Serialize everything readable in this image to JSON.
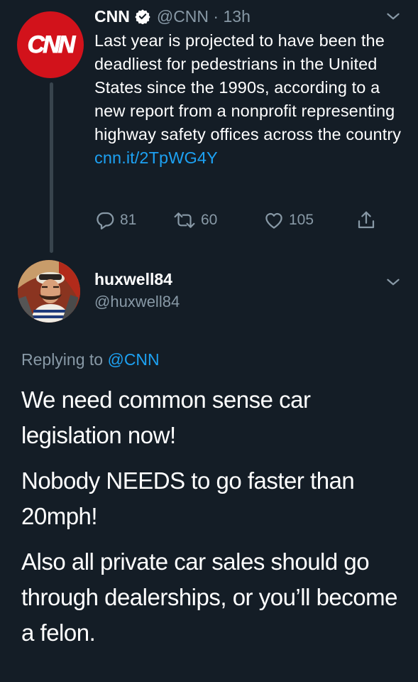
{
  "original_tweet": {
    "avatar_text": "CNN",
    "display_name": "CNN",
    "handle": "@CNN",
    "time_separator": "·",
    "timestamp": "13h",
    "text": "Last year is projected to have been the deadliest for pedestrians in the United States since the 1990s, according to a new report from a nonprofit representing highway safety offices across the country",
    "link": "cnn.it/2TpWG4Y",
    "counts": {
      "replies": "81",
      "retweets": "60",
      "likes": "105"
    }
  },
  "reply_tweet": {
    "display_name": "huxwell84",
    "handle": "@huxwell84",
    "replying_prefix": "Replying to",
    "replying_to": "@CNN",
    "paragraphs": [
      "We need common sense car legislation now!",
      "Nobody NEEDS to go faster than 20mph!",
      "Also all private car sales should go through dealerships, or you’ll become a felon."
    ]
  },
  "colors": {
    "background": "#141d26",
    "text": "#ffffff",
    "muted": "#8899a6",
    "link": "#1da1f2",
    "cnn_red": "#d2121b",
    "thread_line": "#38444d"
  },
  "icons": {
    "verified": "verified-badge-icon",
    "more": "chevron-down-icon",
    "reply": "reply-icon",
    "retweet": "retweet-icon",
    "like": "heart-icon",
    "share": "share-icon"
  }
}
